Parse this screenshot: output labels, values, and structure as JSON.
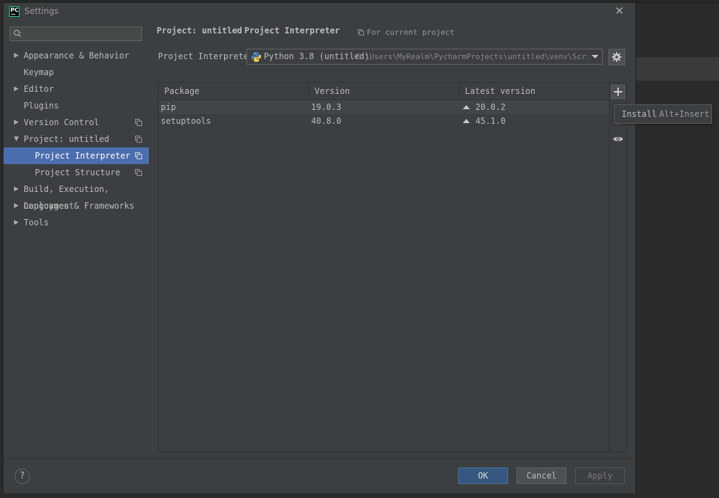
{
  "dialog": {
    "title": "Settings",
    "app_icon_text": "PC"
  },
  "sidebar": {
    "search": {
      "value": "",
      "placeholder": ""
    },
    "items": [
      {
        "label": "Appearance & Behavior",
        "arrow": "▶"
      },
      {
        "label": "Keymap",
        "arrow": ""
      },
      {
        "label": "Editor",
        "arrow": "▶"
      },
      {
        "label": "Plugins",
        "arrow": ""
      },
      {
        "label": "Version Control",
        "arrow": "▶"
      },
      {
        "label": "Project: untitled",
        "arrow": "▼"
      },
      {
        "label": "Project Interpreter",
        "arrow": "",
        "selected": true
      },
      {
        "label": "Project Structure",
        "arrow": ""
      },
      {
        "label": "Build, Execution, Deployment",
        "arrow": "▶"
      },
      {
        "label": "Languages & Frameworks",
        "arrow": "▶"
      },
      {
        "label": "Tools",
        "arrow": "▶"
      }
    ]
  },
  "breadcrumb": {
    "project": "Project: untitled",
    "separator": "›",
    "page": "Project Interpreter",
    "scope": "For current project"
  },
  "interpreter": {
    "label": "Project Interpreter:",
    "name": "Python 3.8 (untitled)",
    "path": "C:\\Users\\MyRealm\\PycharmProjects\\untitled\\venv\\Scripts\\python.exe"
  },
  "packages": {
    "columns": [
      "Package",
      "Version",
      "Latest version"
    ],
    "rows": [
      {
        "package": "pip",
        "version": "19.0.3",
        "latest": "20.0.2"
      },
      {
        "package": "setuptools",
        "version": "40.8.0",
        "latest": "45.1.0"
      }
    ]
  },
  "toolbar": {
    "add": "+",
    "tooltip_text": "Install",
    "tooltip_shortcut": "Alt+Insert"
  },
  "footer": {
    "help": "?",
    "ok": "OK",
    "cancel": "Cancel",
    "apply": "Apply"
  },
  "colors": {
    "selection": "#4b6eaf",
    "primary_button": "#365880",
    "background": "#3c3f41"
  }
}
